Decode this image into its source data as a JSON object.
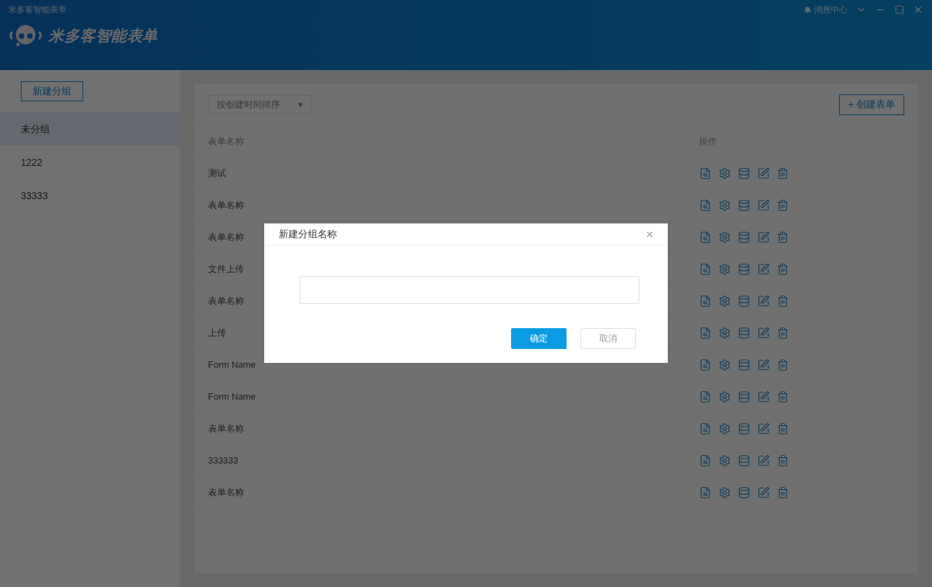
{
  "window": {
    "title": "米多客智能表单",
    "notice": "消息中心"
  },
  "logo": {
    "text": "米多客智能表单"
  },
  "sidebar": {
    "new_group_button": "新建分组",
    "items": [
      {
        "label": "未分组",
        "selected": true
      },
      {
        "label": "1222",
        "selected": false
      },
      {
        "label": "33333",
        "selected": false
      }
    ]
  },
  "toolbar": {
    "sort": "按创建时间排序",
    "sort_caret": "▾",
    "create_button": "+ 创建表单"
  },
  "table": {
    "columns": [
      "表单名称",
      "操作"
    ],
    "rows": [
      {
        "name": "测试"
      },
      {
        "name": "表单名称"
      },
      {
        "name": "表单名称"
      },
      {
        "name": "文件上传"
      },
      {
        "name": "表单名称"
      },
      {
        "name": "上传"
      },
      {
        "name": "Form Name"
      },
      {
        "name": "Form Name"
      },
      {
        "name": "表单名称"
      },
      {
        "name": "333333"
      },
      {
        "name": "表单名称"
      }
    ]
  },
  "dialog": {
    "title": "新建分组名称",
    "close": "×",
    "buttons": {
      "ok": "确定",
      "cancel": "取消"
    }
  }
}
